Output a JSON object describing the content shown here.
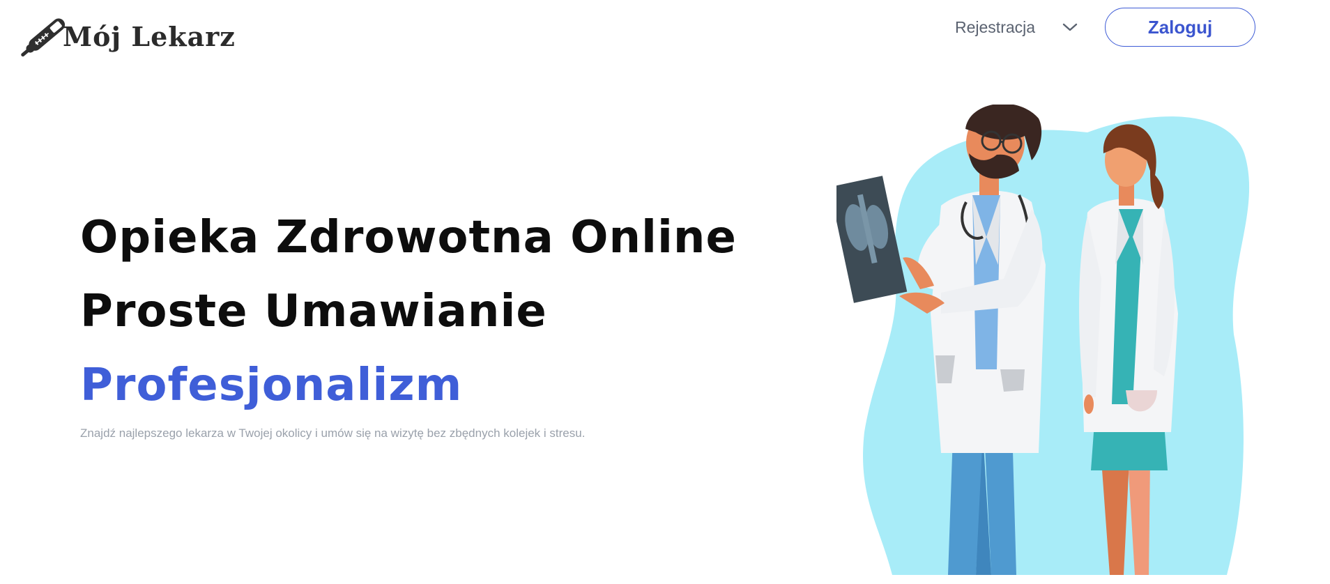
{
  "header": {
    "logo_text": "Mój Lekarz",
    "register_label": "Rejestracja",
    "login_label": "Zaloguj"
  },
  "hero": {
    "line1": "Opieka Zdrowotna Online",
    "line2": "Proste Umawianie",
    "line3": "Profesjonalizm",
    "subtitle": "Znajdź najlepszego lekarza w Twojej okolicy i umów się na wizytę bez zbędnych kolejek i stresu."
  },
  "icons": {
    "logo": "thermometer-icon",
    "register_dropdown": "chevron-down-icon"
  },
  "colors": {
    "accent": "#3f5ed8",
    "heading": "#0d0d0d",
    "subtitle": "#9aa1ab",
    "illustration_blob": "#a8ecf8"
  }
}
